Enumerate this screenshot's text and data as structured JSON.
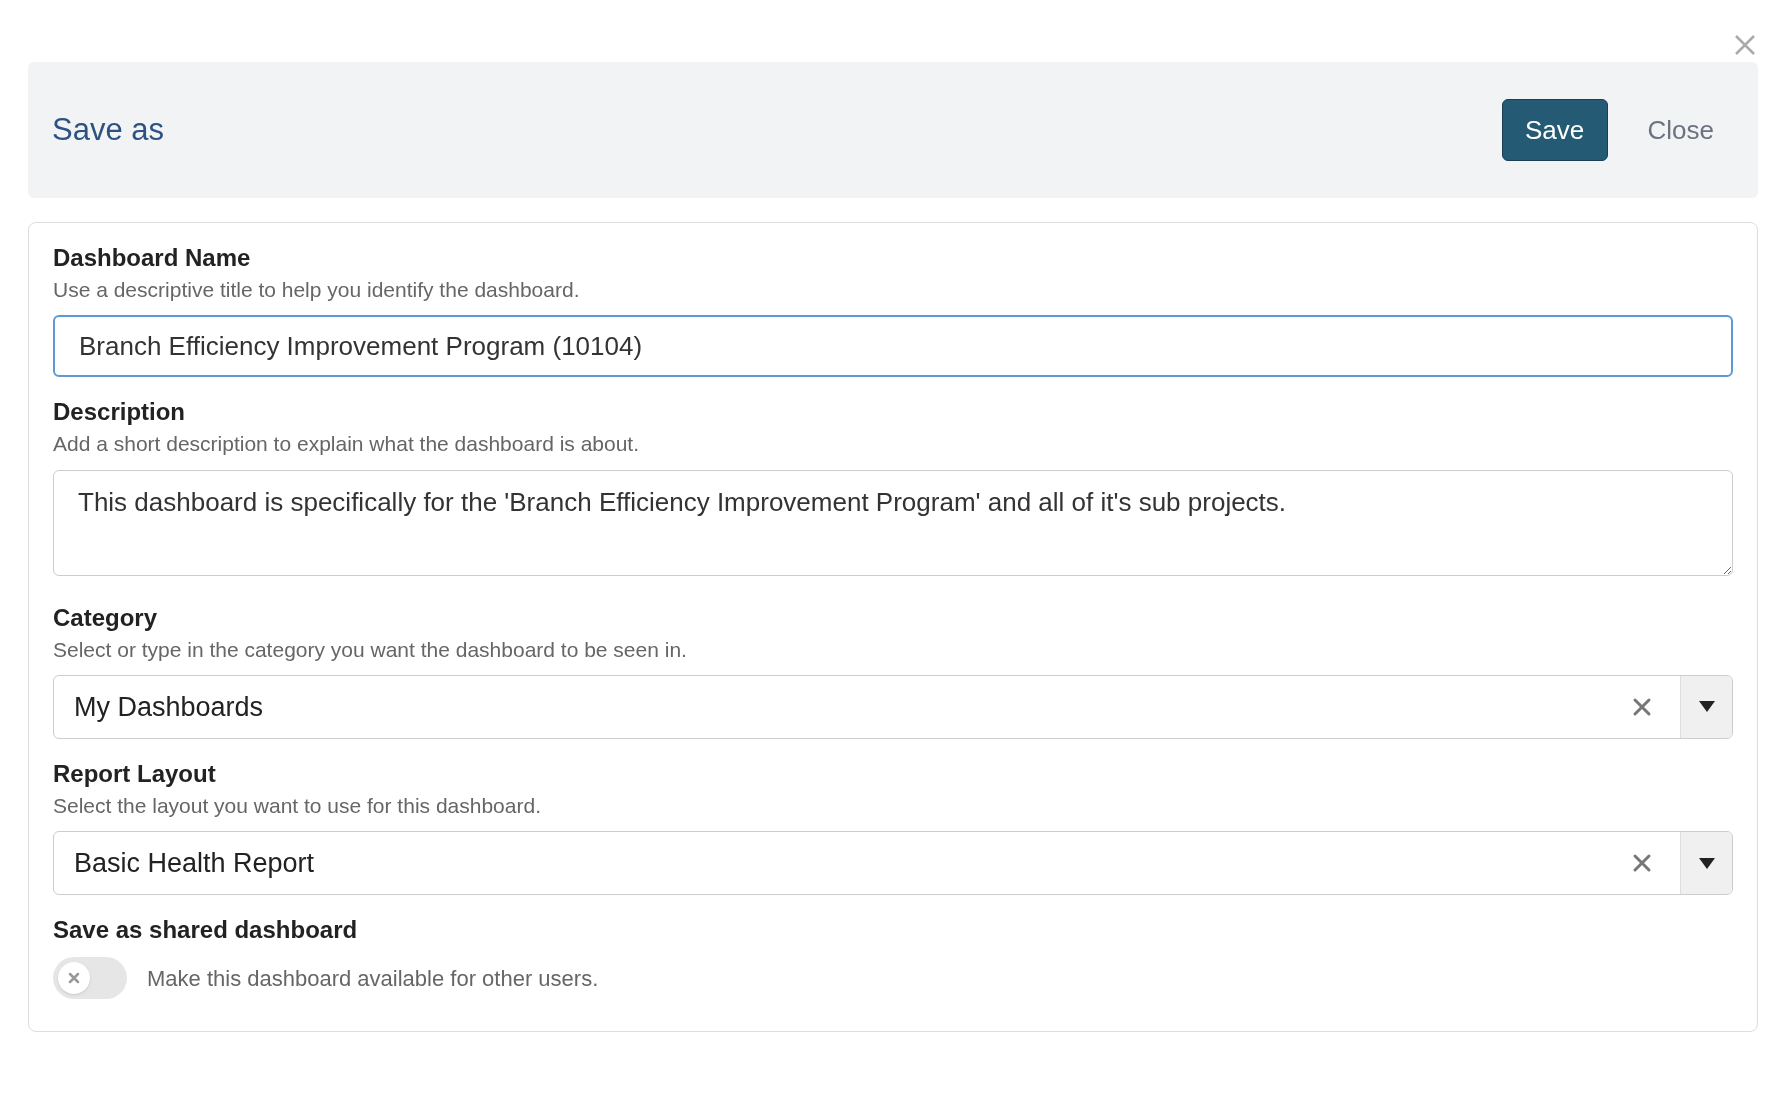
{
  "dialog": {
    "title": "Save as",
    "buttons": {
      "save": "Save",
      "close": "Close"
    }
  },
  "fields": [
    {
      "kind": "text",
      "label": "Dashboard Name",
      "hint": "Use a descriptive title to help you identify the dashboard.",
      "value": "Branch Efficiency Improvement Program (10104)",
      "focused": true
    },
    {
      "kind": "textarea",
      "label": "Description",
      "hint": "Add a short description to explain what the dashboard is about.",
      "value": "This dashboard is specifically for the 'Branch Efficiency Improvement Program' and all of it's sub projects.",
      "focused": false
    },
    {
      "kind": "select",
      "label": "Category",
      "hint": "Select or type in the category you want the dashboard to be seen in.",
      "value": "My Dashboards",
      "focused": false
    },
    {
      "kind": "select",
      "label": "Report Layout",
      "hint": "Select the layout you want to use for this dashboard.",
      "value": "Basic Health Report",
      "focused": false
    },
    {
      "kind": "toggle",
      "label": "Save as shared dashboard",
      "hint": "Make this dashboard available for other users.",
      "on": false
    }
  ]
}
